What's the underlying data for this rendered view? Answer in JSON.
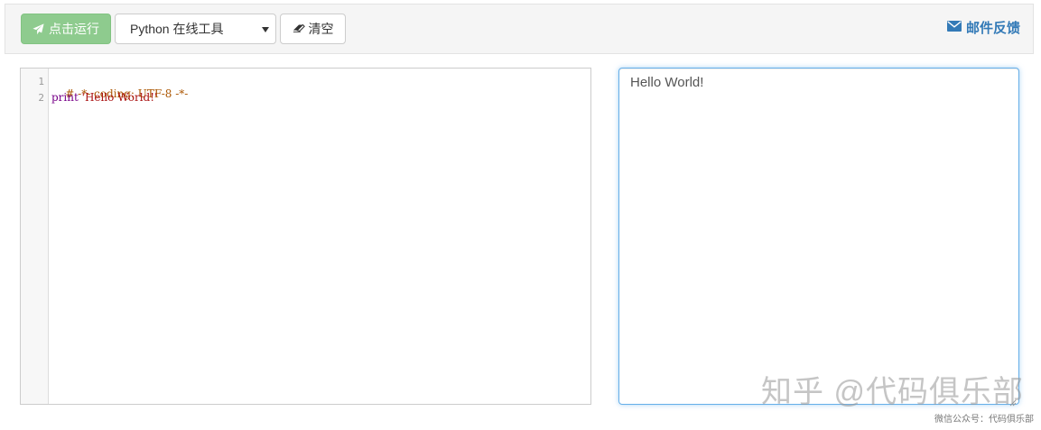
{
  "toolbar": {
    "run_label": "点击运行",
    "run_icon": "paper-plane-icon",
    "language_select": {
      "selected": "Python 在线工具"
    },
    "clear_label": "清空",
    "clear_icon": "eraser-icon",
    "feedback_label": "邮件反馈",
    "feedback_icon": "envelope-icon"
  },
  "editor": {
    "lines": [
      {
        "number": "1",
        "text": "# -*- coding: UTF-8 -*-"
      },
      {
        "number": "2",
        "keyword": "print",
        "string": "'Hello World!'"
      }
    ]
  },
  "output": {
    "text": "Hello World!"
  },
  "watermark": {
    "main": "知乎 @代码俱乐部",
    "small": "微信公众号：代码俱乐部"
  },
  "colors": {
    "run_button": "#8ecb8e",
    "link": "#337ab7",
    "focus_border": "#66afe9",
    "comment": "#aa5500",
    "keyword": "#770088",
    "string": "#aa1111"
  }
}
